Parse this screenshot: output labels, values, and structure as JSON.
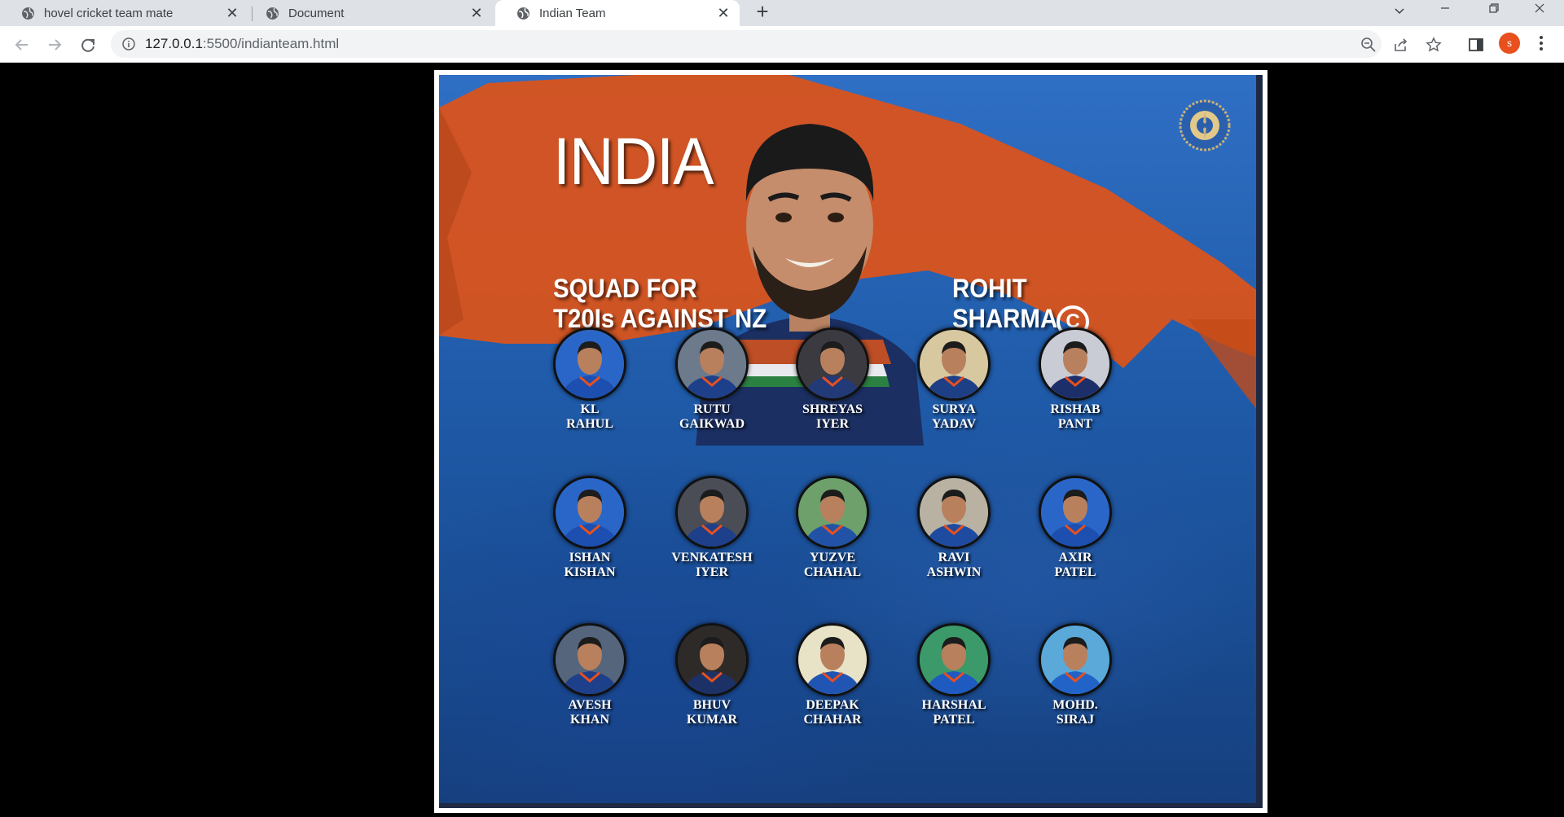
{
  "browser": {
    "tabs": [
      {
        "title": "hovel cricket team mate",
        "active": false
      },
      {
        "title": "Document",
        "active": false
      },
      {
        "title": "Indian Team",
        "active": true
      }
    ],
    "url_host": "127.0.0.1",
    "url_path": ":5500/indianteam.html",
    "profile_initial": "s",
    "profile_color": "#e8501e"
  },
  "poster": {
    "title": "INDIA",
    "subtitle_line1": "SQUAD FOR",
    "subtitle_line2": "T20Is AGAINST NZ",
    "captain_line1": "ROHIT",
    "captain_line2": "SHARMA",
    "captain_badge": "C",
    "players": [
      {
        "name": "KL\nRAHUL",
        "bg": "#2a66c8",
        "jersey": "#1d4fb0"
      },
      {
        "name": "RUTU\nGAIKWAD",
        "bg": "#6c7a8c",
        "jersey": "#1e3f8a"
      },
      {
        "name": "SHREYAS\nIYER",
        "bg": "#3a3a40",
        "jersey": "#223a78"
      },
      {
        "name": "SURYA\nYADAV",
        "bg": "#d8c8a0",
        "jersey": "#1d3f86"
      },
      {
        "name": "RISHAB\nPANT",
        "bg": "#c9ccd4",
        "jersey": "#1c2f6a"
      },
      {
        "name": "ISHAN\nKISHAN",
        "bg": "#2a66c8",
        "jersey": "#1d4fb0"
      },
      {
        "name": "VENKATESH\nIYER",
        "bg": "#4a4d55",
        "jersey": "#1e3f8a"
      },
      {
        "name": "YUZVE\nCHAHAL",
        "bg": "#6da06a",
        "jersey": "#2252a6"
      },
      {
        "name": "RAVI\nASHWIN",
        "bg": "#b9b2a2",
        "jersey": "#1e4aa0"
      },
      {
        "name": "AXIR\nPATEL",
        "bg": "#2a66c8",
        "jersey": "#1d4fb0"
      },
      {
        "name": "AVESH\nKHAN",
        "bg": "#55657c",
        "jersey": "#1e3f8a"
      },
      {
        "name": "BHUV\nKUMAR",
        "bg": "#2e2a28",
        "jersey": "#1c3266"
      },
      {
        "name": "DEEPAK\nCHAHAR",
        "bg": "#e8e2c6",
        "jersey": "#2055b4"
      },
      {
        "name": "HARSHAL\nPATEL",
        "bg": "#3c9a6a",
        "jersey": "#1f5ac0"
      },
      {
        "name": "MOHD.\nSIRAJ",
        "bg": "#5aa9d8",
        "jersey": "#2263c8"
      }
    ]
  },
  "colors": {
    "stripe": "#d9531c",
    "poster_blue": "#1f5aa8"
  }
}
